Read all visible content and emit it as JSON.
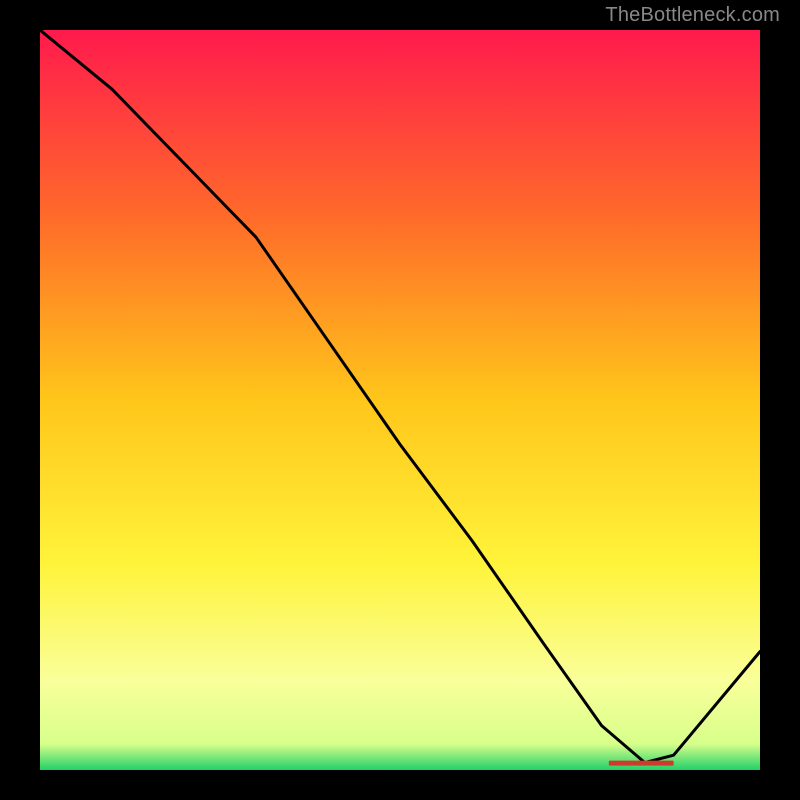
{
  "brand": {
    "attribution": "TheBottleneck.com"
  },
  "colors": {
    "bg": "#000000",
    "attribution": "#888888",
    "curve": "#000000",
    "gradient_stops": [
      {
        "offset": 0.0,
        "color": "#ff1a4d"
      },
      {
        "offset": 0.25,
        "color": "#ff6a2a"
      },
      {
        "offset": 0.5,
        "color": "#ffc61a"
      },
      {
        "offset": 0.72,
        "color": "#fff33a"
      },
      {
        "offset": 0.88,
        "color": "#f9ff9a"
      },
      {
        "offset": 0.965,
        "color": "#d7ff8a"
      },
      {
        "offset": 1.0,
        "color": "#22d06a"
      }
    ],
    "marker": "#cc3b2e"
  },
  "chart_data": {
    "type": "line",
    "title": "",
    "xlabel": "",
    "ylabel": "",
    "xlim": [
      0,
      100
    ],
    "ylim": [
      0,
      100
    ],
    "series": [
      {
        "name": "curve",
        "x": [
          0,
          10,
          22,
          30,
          40,
          50,
          60,
          70,
          78,
          84,
          88,
          100
        ],
        "y": [
          100,
          92,
          80,
          72,
          58,
          44,
          31,
          17,
          6,
          1,
          2,
          16
        ]
      }
    ],
    "marker": {
      "x_start": 79,
      "x_end": 88,
      "y": 1,
      "label": ""
    },
    "grid": false,
    "legend": false
  }
}
